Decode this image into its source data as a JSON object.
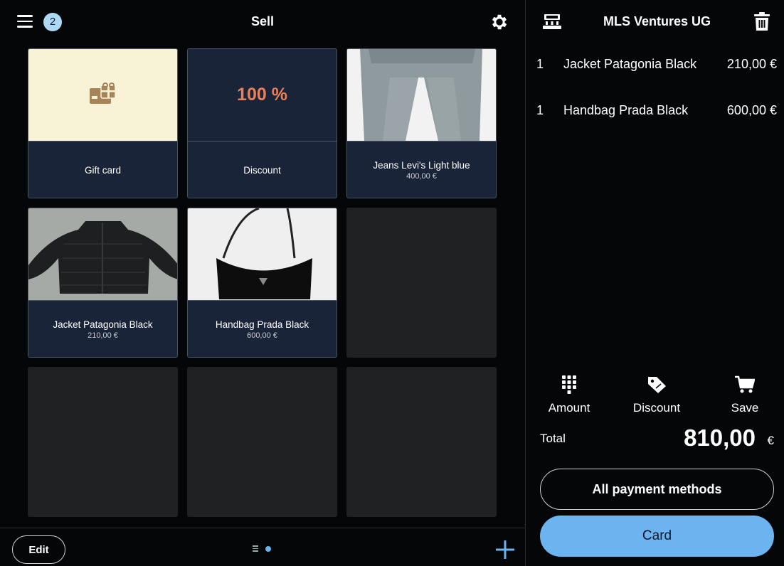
{
  "header": {
    "title": "Sell",
    "notification_count": "2",
    "menu_icon": "hamburger-menu-icon",
    "settings_icon": "gear-icon"
  },
  "tiles": [
    {
      "name": "Gift card",
      "price": "",
      "kind": "gift-card"
    },
    {
      "name": "Discount",
      "price": "",
      "kind": "discount",
      "display": "100 %"
    },
    {
      "name": "Jeans Levi's Light blue",
      "price": "400,00 €",
      "kind": "product"
    },
    {
      "name": "Jacket Patagonia Black",
      "price": "210,00 €",
      "kind": "product"
    },
    {
      "name": "Handbag Prada Black",
      "price": "600,00 €",
      "kind": "product"
    },
    {
      "kind": "empty"
    },
    {
      "kind": "empty"
    },
    {
      "kind": "empty"
    },
    {
      "kind": "empty"
    }
  ],
  "footer": {
    "edit_label": "Edit",
    "add_icon": "plus-icon"
  },
  "cart": {
    "company": "MLS Ventures UG",
    "items": [
      {
        "qty": "1",
        "name": "Jacket Patagonia Black",
        "price": "210,00 €"
      },
      {
        "qty": "1",
        "name": "Handbag Prada Black",
        "price": "600,00 €"
      }
    ],
    "actions": {
      "amount": "Amount",
      "discount": "Discount",
      "save": "Save"
    },
    "total_label": "Total",
    "total_value": "810,00",
    "total_currency": "€",
    "pay_all_label": "All payment methods",
    "pay_card_label": "Card"
  },
  "colors": {
    "accent": "#6cb4f0",
    "tile_bg": "#1a2438",
    "discount_text": "#e8805c",
    "gift_bg": "#f8f2d6"
  }
}
